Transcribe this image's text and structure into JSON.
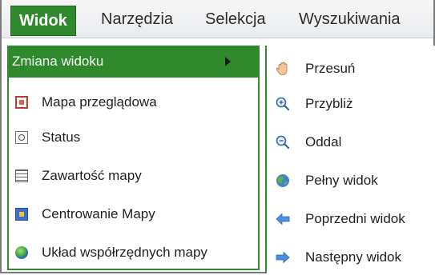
{
  "menubar": {
    "items": [
      {
        "label": "Widok",
        "active": true
      },
      {
        "label": "Narzędzia",
        "active": false
      },
      {
        "label": "Selekcja",
        "active": false
      },
      {
        "label": "Wyszukiwania",
        "active": false
      }
    ]
  },
  "left_menu": {
    "header": "Zmiana widoku",
    "items": [
      {
        "label": "Mapa przeglądowa",
        "icon": "overview-map-icon"
      },
      {
        "label": "Status",
        "icon": "status-icon"
      },
      {
        "label": "Zawartość mapy",
        "icon": "map-contents-icon"
      },
      {
        "label": "Centrowanie Mapy",
        "icon": "center-map-icon"
      },
      {
        "label": "Układ współrzędnych mapy",
        "icon": "globe-icon"
      }
    ]
  },
  "submenu": {
    "items": [
      {
        "label": "Przesuń",
        "icon": "hand-pan-icon"
      },
      {
        "label": "Przybliż",
        "icon": "zoom-in-icon"
      },
      {
        "label": "Oddal",
        "icon": "zoom-out-icon"
      },
      {
        "label": "Pełny widok",
        "icon": "globe-icon"
      },
      {
        "label": "Poprzedni widok",
        "icon": "arrow-left-icon"
      },
      {
        "label": "Następny widok",
        "icon": "arrow-right-icon"
      }
    ]
  },
  "colors": {
    "accent": "#2f8a2d",
    "frame": "#7a7a7a"
  }
}
